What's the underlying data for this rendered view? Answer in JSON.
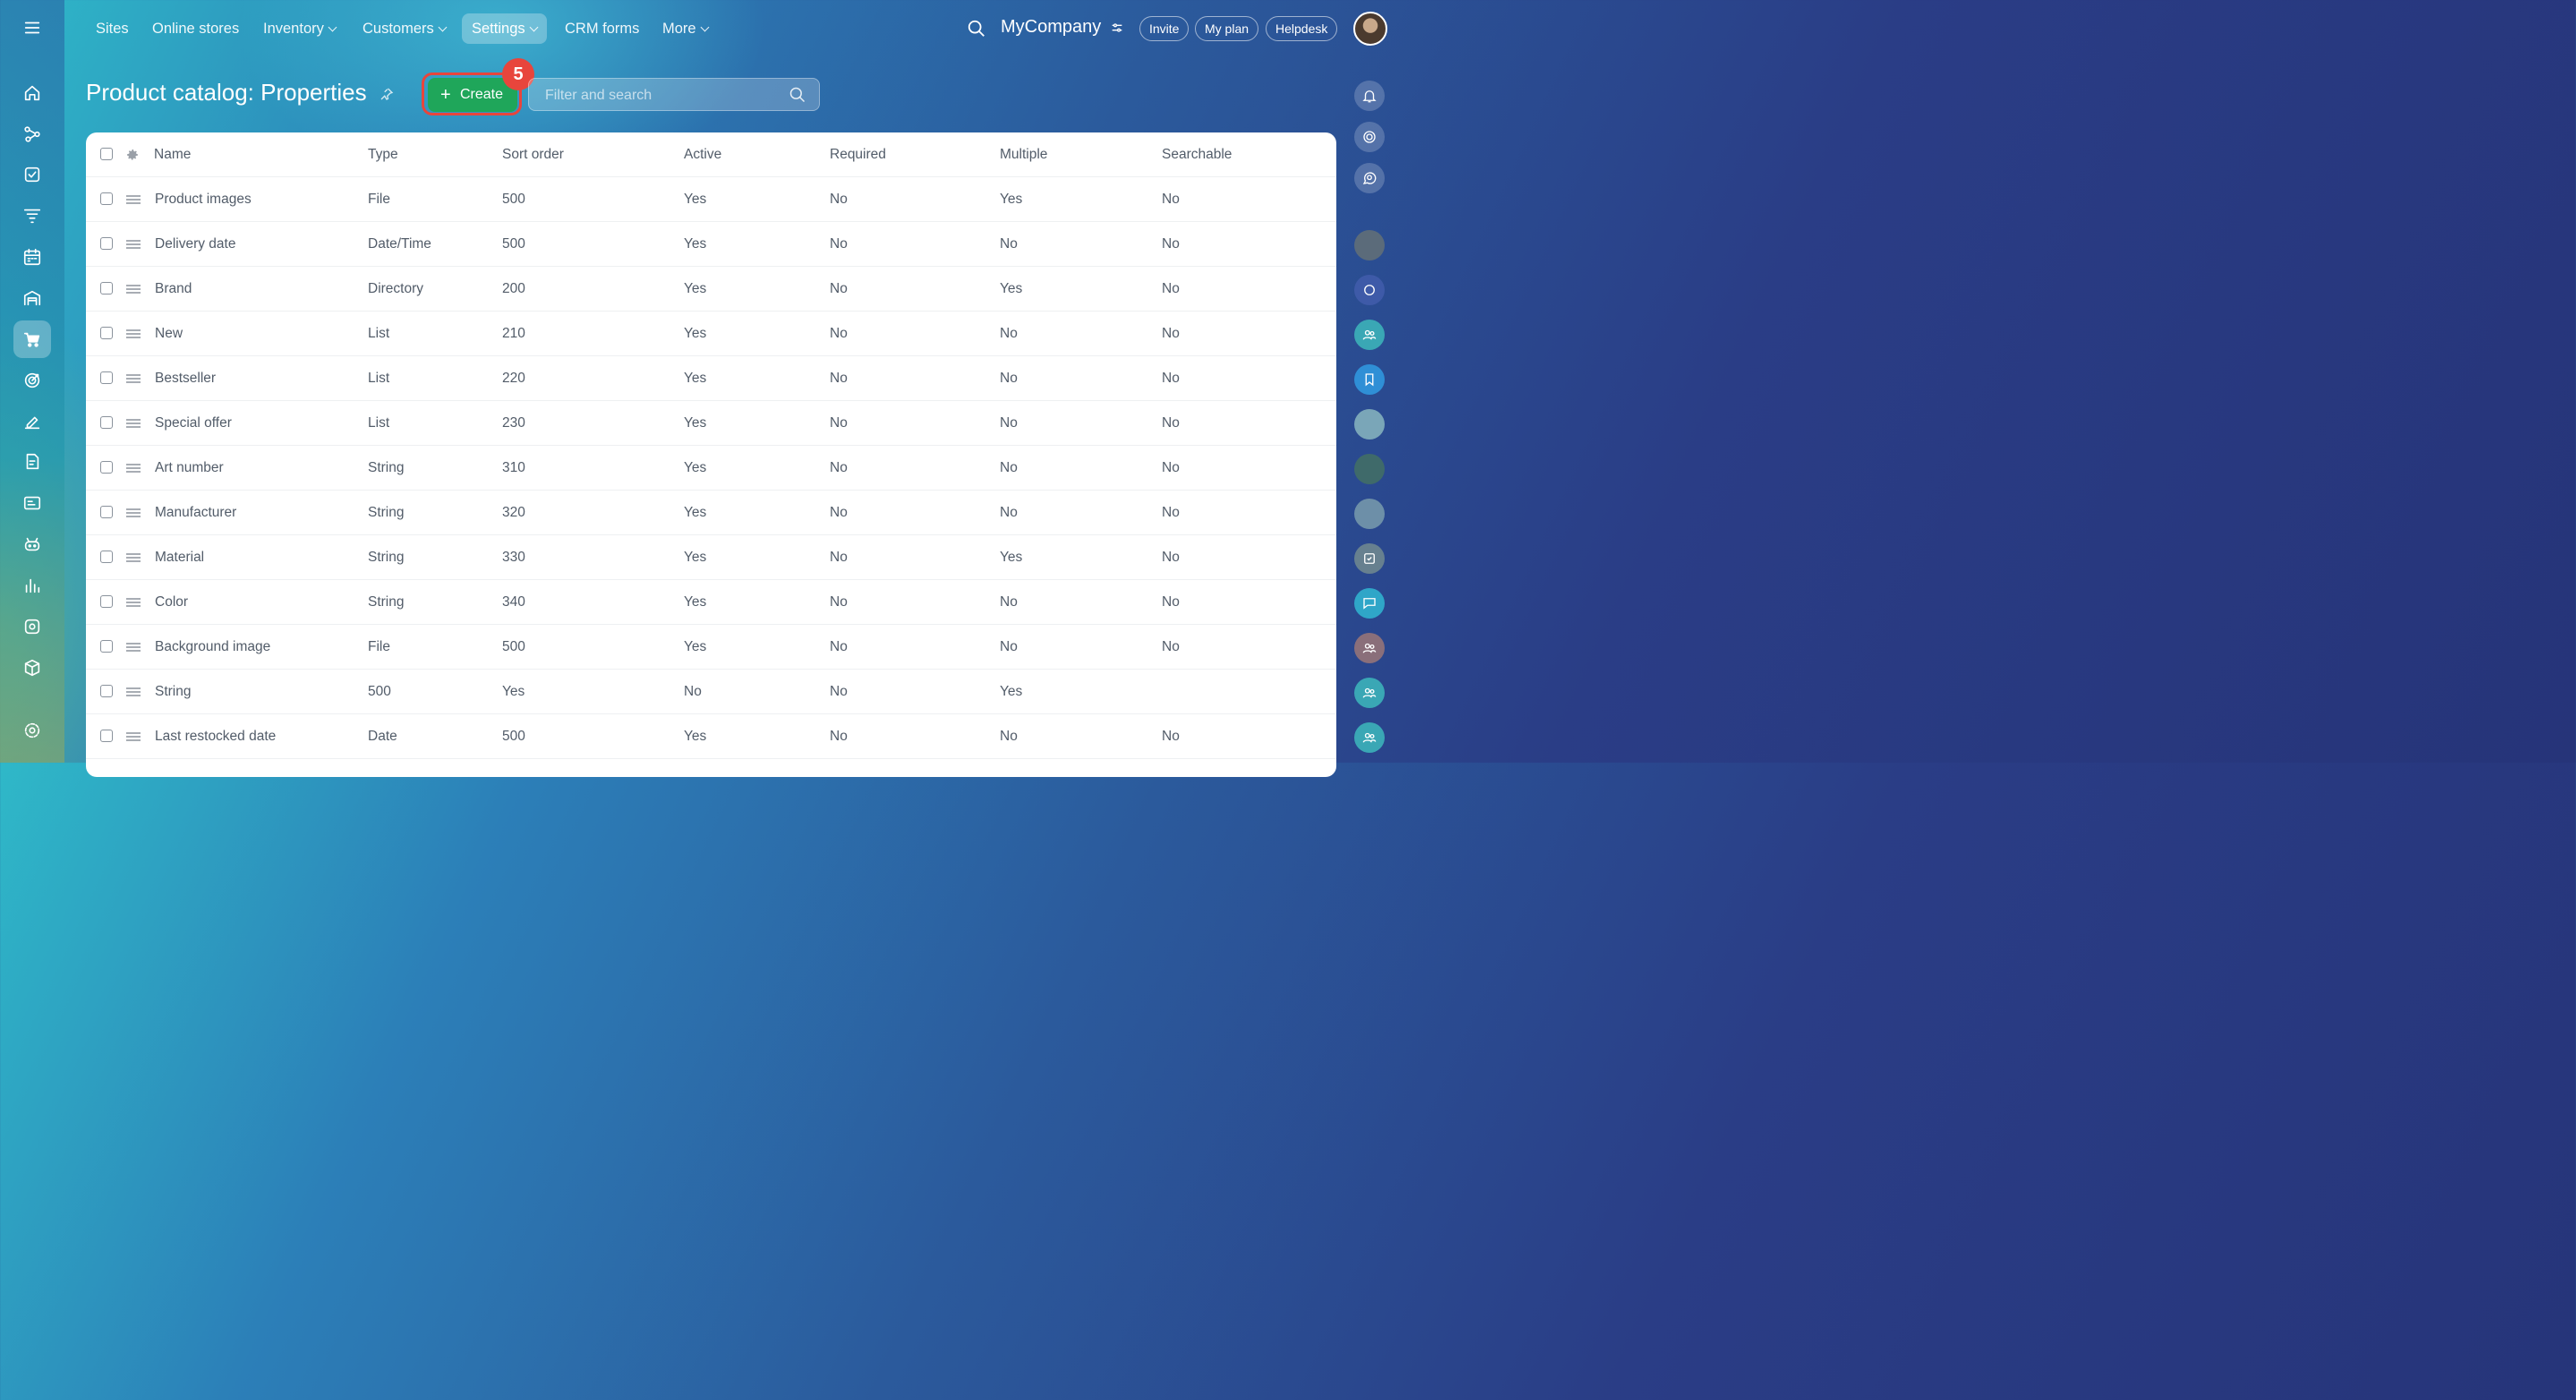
{
  "nav": {
    "items": [
      {
        "label": "Sites"
      },
      {
        "label": "Online stores"
      },
      {
        "label": "Inventory"
      },
      {
        "label": "Customers"
      },
      {
        "label": "Settings"
      },
      {
        "label": "CRM forms"
      },
      {
        "label": "More"
      }
    ],
    "company": "MyCompany",
    "invite": "Invite",
    "my_plan": "My plan",
    "helpdesk": "Helpdesk"
  },
  "page": {
    "title": "Product catalog: Properties",
    "create_label": "Create",
    "step_badge": "5",
    "search_placeholder": "Filter and search"
  },
  "table": {
    "headers": [
      "Name",
      "Type",
      "Sort order",
      "Active",
      "Required",
      "Multiple",
      "Searchable"
    ],
    "rows": [
      [
        "Product images",
        "File",
        "500",
        "Yes",
        "No",
        "Yes",
        "No"
      ],
      [
        "Delivery date",
        "Date/Time",
        "500",
        "Yes",
        "No",
        "No",
        "No"
      ],
      [
        "Brand",
        "Directory",
        "200",
        "Yes",
        "No",
        "Yes",
        "No"
      ],
      [
        "New",
        "List",
        "210",
        "Yes",
        "No",
        "No",
        "No"
      ],
      [
        "Bestseller",
        "List",
        "220",
        "Yes",
        "No",
        "No",
        "No"
      ],
      [
        "Special offer",
        "List",
        "230",
        "Yes",
        "No",
        "No",
        "No"
      ],
      [
        "Art number",
        "String",
        "310",
        "Yes",
        "No",
        "No",
        "No"
      ],
      [
        "Manufacturer",
        "String",
        "320",
        "Yes",
        "No",
        "No",
        "No"
      ],
      [
        "Material",
        "String",
        "330",
        "Yes",
        "No",
        "Yes",
        "No"
      ],
      [
        "Color",
        "String",
        "340",
        "Yes",
        "No",
        "No",
        "No"
      ],
      [
        "Background image",
        "File",
        "500",
        "Yes",
        "No",
        "No",
        "No"
      ],
      [
        "String",
        "500",
        "Yes",
        "No",
        "No",
        "Yes",
        ""
      ],
      [
        "Last restocked date",
        "Date",
        "500",
        "Yes",
        "No",
        "No",
        "No"
      ]
    ]
  },
  "colors": {
    "create": "#1fa65a",
    "highlight": "#e8453c"
  }
}
